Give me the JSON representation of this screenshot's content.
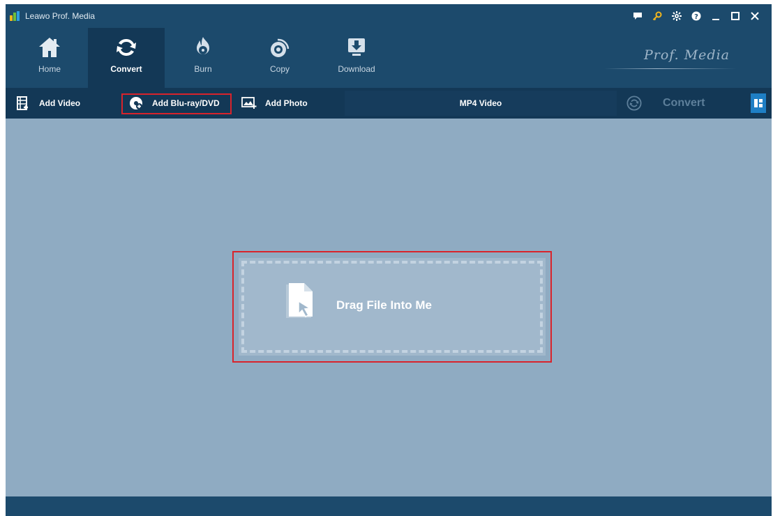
{
  "window": {
    "title": "Leawo Prof. Media"
  },
  "nav": {
    "items": [
      {
        "label": "Home",
        "icon": "home-icon"
      },
      {
        "label": "Convert",
        "icon": "convert-icon",
        "active": true
      },
      {
        "label": "Burn",
        "icon": "burn-icon"
      },
      {
        "label": "Copy",
        "icon": "copy-icon"
      },
      {
        "label": "Download",
        "icon": "download-icon"
      }
    ],
    "brand": "Prof. Media"
  },
  "toolbar": {
    "add_video": "Add Video",
    "add_bluray": "Add Blu-ray/DVD",
    "add_photo": "Add Photo",
    "format": "MP4 Video",
    "convert": "Convert"
  },
  "dropzone": {
    "text": "Drag File Into Me"
  },
  "colors": {
    "titlebar": "#1c4a6c",
    "toolbar": "#133856",
    "workspace": "#8fabc2",
    "highlight": "#d9232b",
    "accent": "#1e7fc5"
  }
}
